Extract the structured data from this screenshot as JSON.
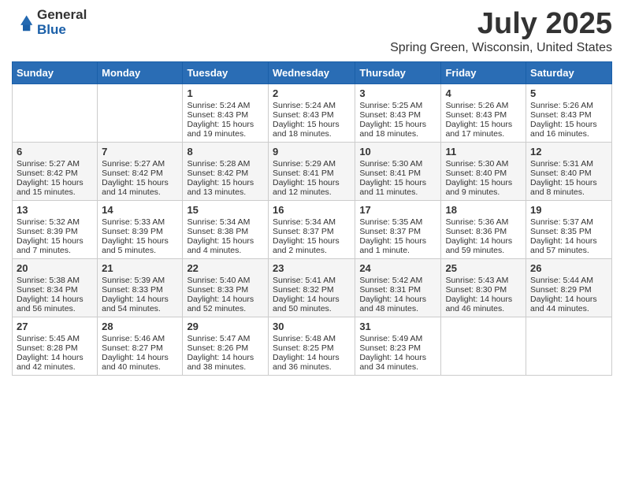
{
  "logo": {
    "general": "General",
    "blue": "Blue"
  },
  "title": "July 2025",
  "location": "Spring Green, Wisconsin, United States",
  "days_of_week": [
    "Sunday",
    "Monday",
    "Tuesday",
    "Wednesday",
    "Thursday",
    "Friday",
    "Saturday"
  ],
  "weeks": [
    [
      {
        "day": "",
        "info": ""
      },
      {
        "day": "",
        "info": ""
      },
      {
        "day": "1",
        "info": "Sunrise: 5:24 AM\nSunset: 8:43 PM\nDaylight: 15 hours and 19 minutes."
      },
      {
        "day": "2",
        "info": "Sunrise: 5:24 AM\nSunset: 8:43 PM\nDaylight: 15 hours and 18 minutes."
      },
      {
        "day": "3",
        "info": "Sunrise: 5:25 AM\nSunset: 8:43 PM\nDaylight: 15 hours and 18 minutes."
      },
      {
        "day": "4",
        "info": "Sunrise: 5:26 AM\nSunset: 8:43 PM\nDaylight: 15 hours and 17 minutes."
      },
      {
        "day": "5",
        "info": "Sunrise: 5:26 AM\nSunset: 8:43 PM\nDaylight: 15 hours and 16 minutes."
      }
    ],
    [
      {
        "day": "6",
        "info": "Sunrise: 5:27 AM\nSunset: 8:42 PM\nDaylight: 15 hours and 15 minutes."
      },
      {
        "day": "7",
        "info": "Sunrise: 5:27 AM\nSunset: 8:42 PM\nDaylight: 15 hours and 14 minutes."
      },
      {
        "day": "8",
        "info": "Sunrise: 5:28 AM\nSunset: 8:42 PM\nDaylight: 15 hours and 13 minutes."
      },
      {
        "day": "9",
        "info": "Sunrise: 5:29 AM\nSunset: 8:41 PM\nDaylight: 15 hours and 12 minutes."
      },
      {
        "day": "10",
        "info": "Sunrise: 5:30 AM\nSunset: 8:41 PM\nDaylight: 15 hours and 11 minutes."
      },
      {
        "day": "11",
        "info": "Sunrise: 5:30 AM\nSunset: 8:40 PM\nDaylight: 15 hours and 9 minutes."
      },
      {
        "day": "12",
        "info": "Sunrise: 5:31 AM\nSunset: 8:40 PM\nDaylight: 15 hours and 8 minutes."
      }
    ],
    [
      {
        "day": "13",
        "info": "Sunrise: 5:32 AM\nSunset: 8:39 PM\nDaylight: 15 hours and 7 minutes."
      },
      {
        "day": "14",
        "info": "Sunrise: 5:33 AM\nSunset: 8:39 PM\nDaylight: 15 hours and 5 minutes."
      },
      {
        "day": "15",
        "info": "Sunrise: 5:34 AM\nSunset: 8:38 PM\nDaylight: 15 hours and 4 minutes."
      },
      {
        "day": "16",
        "info": "Sunrise: 5:34 AM\nSunset: 8:37 PM\nDaylight: 15 hours and 2 minutes."
      },
      {
        "day": "17",
        "info": "Sunrise: 5:35 AM\nSunset: 8:37 PM\nDaylight: 15 hours and 1 minute."
      },
      {
        "day": "18",
        "info": "Sunrise: 5:36 AM\nSunset: 8:36 PM\nDaylight: 14 hours and 59 minutes."
      },
      {
        "day": "19",
        "info": "Sunrise: 5:37 AM\nSunset: 8:35 PM\nDaylight: 14 hours and 57 minutes."
      }
    ],
    [
      {
        "day": "20",
        "info": "Sunrise: 5:38 AM\nSunset: 8:34 PM\nDaylight: 14 hours and 56 minutes."
      },
      {
        "day": "21",
        "info": "Sunrise: 5:39 AM\nSunset: 8:33 PM\nDaylight: 14 hours and 54 minutes."
      },
      {
        "day": "22",
        "info": "Sunrise: 5:40 AM\nSunset: 8:33 PM\nDaylight: 14 hours and 52 minutes."
      },
      {
        "day": "23",
        "info": "Sunrise: 5:41 AM\nSunset: 8:32 PM\nDaylight: 14 hours and 50 minutes."
      },
      {
        "day": "24",
        "info": "Sunrise: 5:42 AM\nSunset: 8:31 PM\nDaylight: 14 hours and 48 minutes."
      },
      {
        "day": "25",
        "info": "Sunrise: 5:43 AM\nSunset: 8:30 PM\nDaylight: 14 hours and 46 minutes."
      },
      {
        "day": "26",
        "info": "Sunrise: 5:44 AM\nSunset: 8:29 PM\nDaylight: 14 hours and 44 minutes."
      }
    ],
    [
      {
        "day": "27",
        "info": "Sunrise: 5:45 AM\nSunset: 8:28 PM\nDaylight: 14 hours and 42 minutes."
      },
      {
        "day": "28",
        "info": "Sunrise: 5:46 AM\nSunset: 8:27 PM\nDaylight: 14 hours and 40 minutes."
      },
      {
        "day": "29",
        "info": "Sunrise: 5:47 AM\nSunset: 8:26 PM\nDaylight: 14 hours and 38 minutes."
      },
      {
        "day": "30",
        "info": "Sunrise: 5:48 AM\nSunset: 8:25 PM\nDaylight: 14 hours and 36 minutes."
      },
      {
        "day": "31",
        "info": "Sunrise: 5:49 AM\nSunset: 8:23 PM\nDaylight: 14 hours and 34 minutes."
      },
      {
        "day": "",
        "info": ""
      },
      {
        "day": "",
        "info": ""
      }
    ]
  ]
}
